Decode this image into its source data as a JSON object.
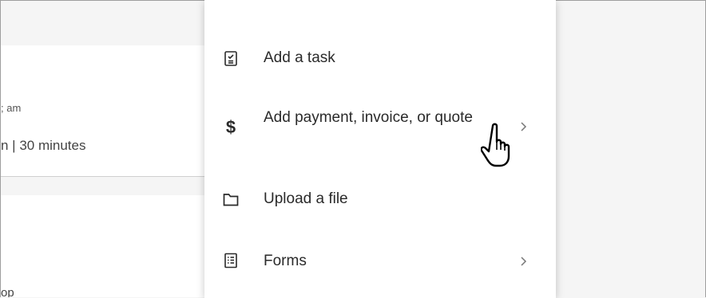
{
  "background": {
    "card1": {
      "time_fragment": "; am",
      "duration_fragment": "n | 30 minutes"
    },
    "card2": {
      "text_fragment": "op"
    }
  },
  "menu": {
    "items": [
      {
        "label": "Add a task",
        "icon": "task-icon",
        "has_submenu": false
      },
      {
        "label": "Add payment, invoice, or quote",
        "icon": "dollar-icon",
        "has_submenu": true
      },
      {
        "label": "Upload a file",
        "icon": "folder-icon",
        "has_submenu": false
      },
      {
        "label": "Forms",
        "icon": "forms-icon",
        "has_submenu": true
      }
    ]
  },
  "colors": {
    "menu_bg": "#ffffff",
    "page_bg": "#f5f5f5",
    "text": "#2a2a2a",
    "chevron": "#777777"
  }
}
